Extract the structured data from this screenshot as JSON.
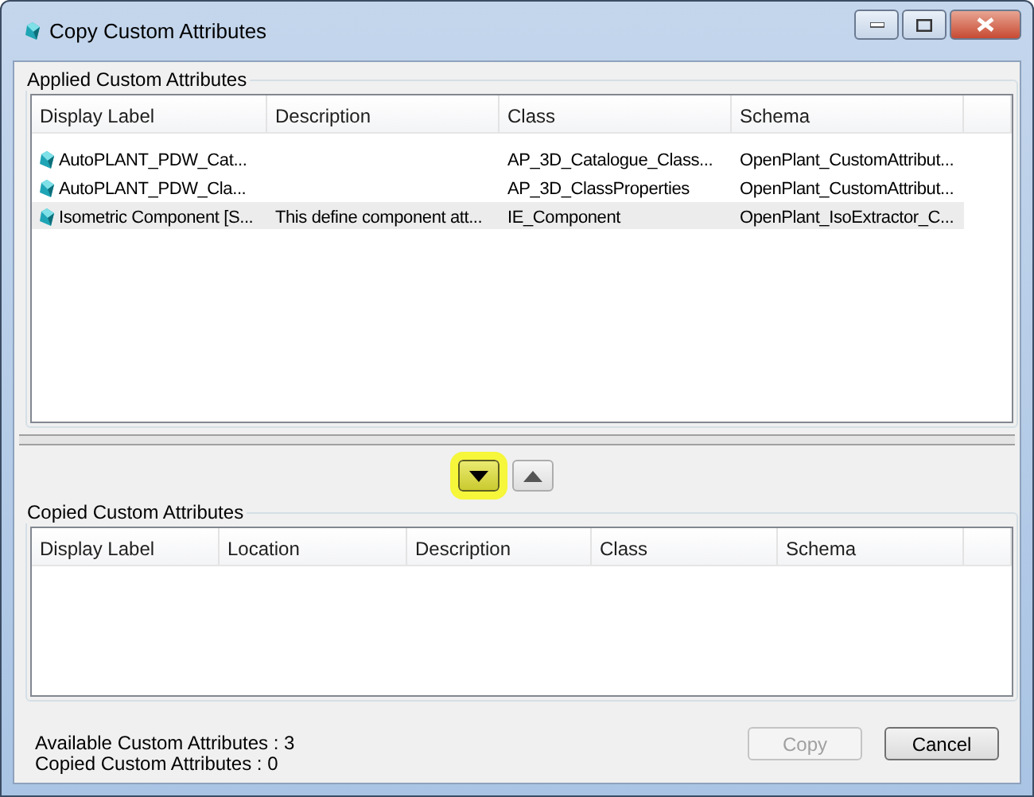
{
  "window": {
    "title": "Copy Custom Attributes"
  },
  "applied": {
    "title": "Applied Custom Attributes",
    "columns": [
      "Display Label",
      "Description",
      "Class",
      "Schema"
    ],
    "rows": [
      {
        "cells": [
          "AutoPLANT_PDW_Cat...",
          "",
          "AP_3D_Catalogue_Class...",
          "OpenPlant_CustomAttribut..."
        ],
        "selected": false
      },
      {
        "cells": [
          "AutoPLANT_PDW_Cla...",
          "",
          "AP_3D_ClassProperties",
          "OpenPlant_CustomAttribut..."
        ],
        "selected": false
      },
      {
        "cells": [
          "Isometric Component [S...",
          "This define component att...",
          "IE_Component",
          "OpenPlant_IsoExtractor_C..."
        ],
        "selected": true
      }
    ]
  },
  "move_buttons": [
    {
      "kind": "down",
      "highlighted": true
    },
    {
      "kind": "up",
      "highlighted": false
    }
  ],
  "copied": {
    "title": "Copied Custom Attributes",
    "columns": [
      "Display Label",
      "Location",
      "Description",
      "Class",
      "Schema"
    ]
  },
  "status": [
    "Available Custom Attributes : 3",
    "Copied Custom Attributes : 0"
  ],
  "buttons": [
    {
      "label": "Copy",
      "disabled": true
    },
    {
      "label": "Cancel",
      "disabled": false
    }
  ]
}
